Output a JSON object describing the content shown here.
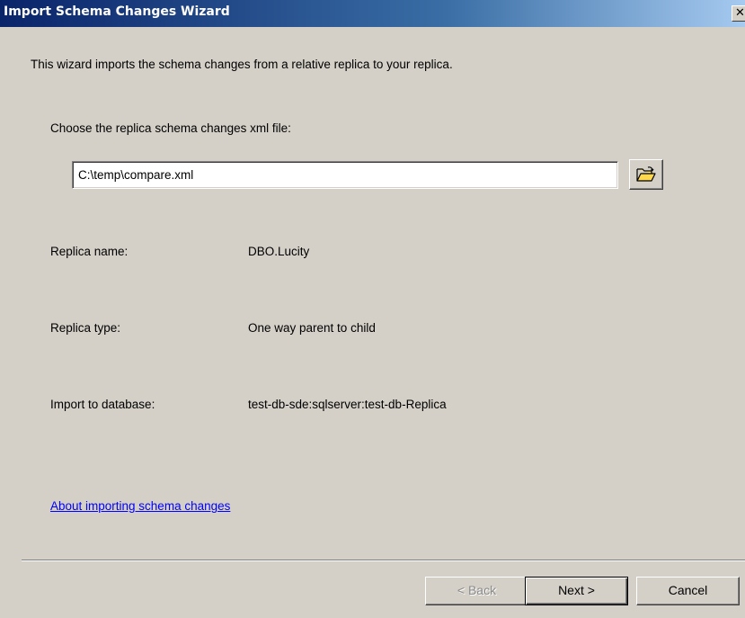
{
  "window": {
    "title": "Import Schema Changes Wizard",
    "close_glyph": "✕"
  },
  "intro_text": "This wizard imports the schema changes from a relative replica to your replica.",
  "file_section": {
    "label": "Choose the replica schema changes xml file:",
    "value": "C:\\temp\\compare.xml",
    "browse_icon": "open-folder-icon"
  },
  "details": [
    {
      "label": "Replica name:",
      "value": "DBO.Lucity"
    },
    {
      "label": "Replica type:",
      "value": "One way parent to child"
    },
    {
      "label": "Import to database:",
      "value": "test-db-sde:sqlserver:test-db-Replica"
    }
  ],
  "help_link": "About importing schema changes",
  "buttons": {
    "back": "< Back",
    "next": "Next >",
    "cancel": "Cancel"
  },
  "colors": {
    "dialog_bg": "#d4d0c8",
    "title_bar": "#0a246a",
    "link": "#0000ff"
  }
}
